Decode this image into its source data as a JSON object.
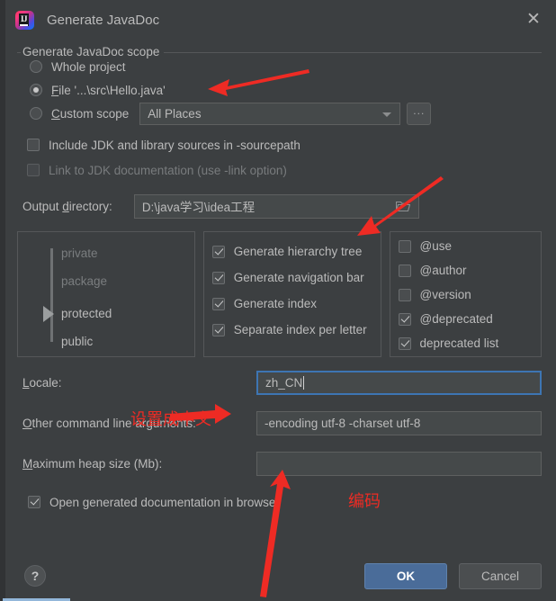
{
  "window": {
    "title": "Generate JavaDoc",
    "app_icon": "intellij-idea-icon",
    "close_icon": "✕"
  },
  "scope": {
    "group_title": "Generate JavaDoc scope",
    "options": [
      {
        "label": "Whole project",
        "mnemonic": "",
        "selected": false
      },
      {
        "label": "File '...\\src\\Hello.java'",
        "mnemonic": "F",
        "selected": true
      },
      {
        "label": "Custom scope",
        "mnemonic": "C",
        "selected": false
      }
    ],
    "custom_scope_value": "All Places",
    "ellipsis_label": "...",
    "dropdown_icon": "chevron-down-icon"
  },
  "options_checkboxes": [
    {
      "label": "Include JDK and library sources in -sourcepath",
      "checked": false,
      "disabled": false
    },
    {
      "label": "Link to JDK documentation (use -link option)",
      "checked": false,
      "disabled": true
    }
  ],
  "output": {
    "label": "Output directory:",
    "mnemonic_prefix": "Output ",
    "mnemonic_char": "d",
    "mnemonic_suffix": "irectory:",
    "value": "D:\\java学习\\idea工程",
    "browse_icon": "folder-icon"
  },
  "visibility": {
    "levels": [
      "private",
      "package",
      "protected",
      "public"
    ],
    "selected": "protected",
    "disabled_levels": [
      "private",
      "package"
    ]
  },
  "generate_options": [
    {
      "label": "Generate hierarchy tree",
      "checked": true
    },
    {
      "label": "Generate navigation bar",
      "checked": true
    },
    {
      "label": "Generate index",
      "checked": true
    },
    {
      "label": "Separate index per letter",
      "checked": true
    }
  ],
  "tag_options": [
    {
      "label": "@use",
      "checked": false
    },
    {
      "label": "@author",
      "checked": false
    },
    {
      "label": "@version",
      "checked": false
    },
    {
      "label": "@deprecated",
      "checked": true
    },
    {
      "label": "deprecated list",
      "checked": true
    }
  ],
  "locale": {
    "label_prefix": "",
    "mnemonic_char": "L",
    "label_suffix": "ocale:",
    "value": "zh_CN",
    "focused": true
  },
  "cmdline": {
    "mnemonic_char": "O",
    "label_suffix": "ther command line arguments:",
    "value": "-encoding utf-8 -charset utf-8"
  },
  "heap": {
    "mnemonic_char": "M",
    "label_suffix": "aximum heap size (Mb):",
    "value": ""
  },
  "open_in_browser": {
    "label": "Open generated documentation in browser",
    "checked": true
  },
  "footer": {
    "help_label": "?",
    "ok_label": "OK",
    "cancel_label": "Cancel"
  },
  "annotations": {
    "locale_note": "设置成中文",
    "encoding_note": "编码",
    "arrow_color": "#ee2b24"
  }
}
